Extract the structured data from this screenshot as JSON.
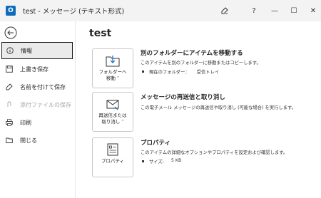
{
  "window": {
    "title": "test  -  メッセージ (テキスト形式)",
    "app_icon_letter": "O",
    "buttons": {
      "help": "?",
      "minimize": "—",
      "maximize": "☐",
      "close": "✕"
    }
  },
  "sidebar": {
    "items": [
      {
        "label": "情報",
        "icon": "info-icon",
        "active": true,
        "disabled": false
      },
      {
        "label": "上書き保存",
        "icon": "save-icon",
        "active": false,
        "disabled": false
      },
      {
        "label": "名前を付けて保存",
        "icon": "save-as-icon",
        "active": false,
        "disabled": false
      },
      {
        "label": "添付ファイルの保存",
        "icon": "attachment-save-icon",
        "active": false,
        "disabled": true
      },
      {
        "label": "印刷",
        "icon": "print-icon",
        "active": false,
        "disabled": false
      },
      {
        "label": "閉じる",
        "icon": "close-folder-icon",
        "active": false,
        "disabled": false
      }
    ]
  },
  "main": {
    "heading": "test",
    "sections": [
      {
        "button_label": "フォルダーへ\n移動 ˅",
        "title": "別のフォルダーにアイテムを移動する",
        "description": "このアイテムを別のフォルダーに移動またはコピーします。",
        "bullet_key": "現在のフォルダー：",
        "bullet_value": "受信トレイ"
      },
      {
        "button_label": "再送信または\n取り消し ˅",
        "title": "メッセージの再送信と取り消し",
        "description": "この電子メール メッセージの再送信や取り消し (可能な場合) を実行します。"
      },
      {
        "button_label": "プロパティ",
        "title": "プロパティ",
        "description": "このアイテムの詳細なオプションやプロパティを設定および確認します。",
        "bullet_key": "サイズ:",
        "bullet_value": "5 KB"
      }
    ]
  }
}
